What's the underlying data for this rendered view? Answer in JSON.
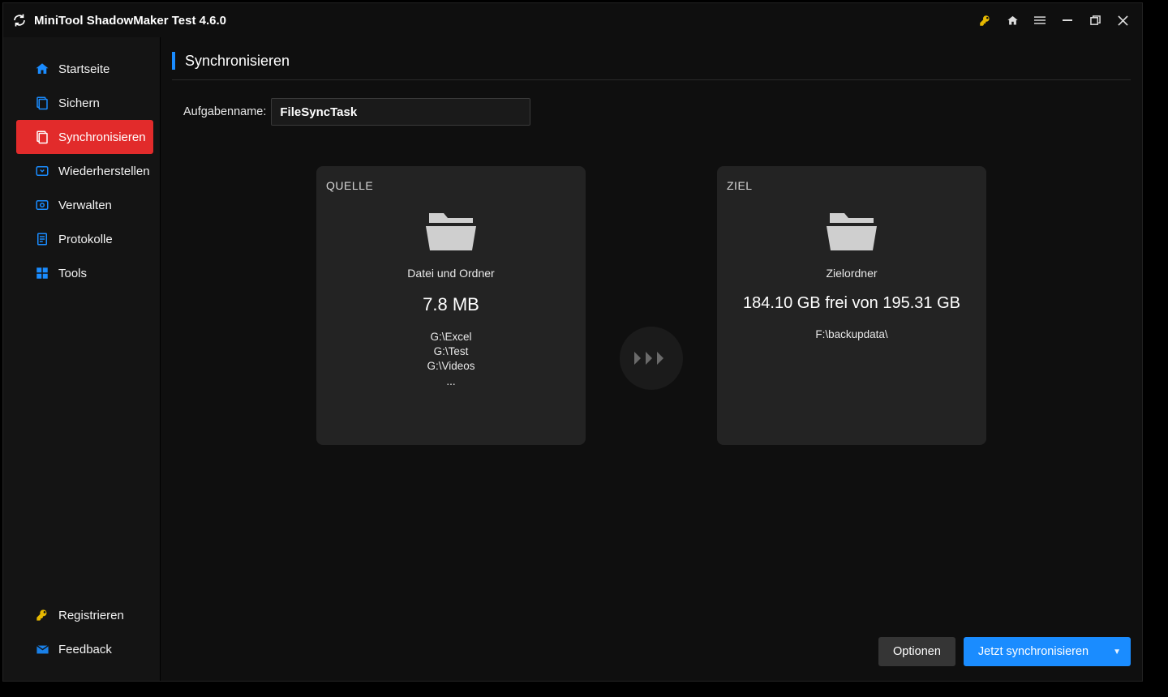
{
  "app": {
    "title": "MiniTool ShadowMaker Test 4.6.0"
  },
  "sidebar": {
    "items": [
      {
        "label": "Startseite"
      },
      {
        "label": "Sichern"
      },
      {
        "label": "Synchronisieren"
      },
      {
        "label": "Wiederherstellen"
      },
      {
        "label": "Verwalten"
      },
      {
        "label": "Protokolle"
      },
      {
        "label": "Tools"
      }
    ],
    "bottom": {
      "register": "Registrieren",
      "feedback": "Feedback"
    }
  },
  "page": {
    "title": "Synchronisieren",
    "task_label": "Aufgabenname:",
    "task_value": "FileSyncTask"
  },
  "source": {
    "heading": "QUELLE",
    "subtitle": "Datei und Ordner",
    "size": "7.8 MB",
    "paths": [
      "G:\\Excel",
      "G:\\Test",
      "G:\\Videos"
    ],
    "more": "..."
  },
  "target": {
    "heading": "ZIEL",
    "subtitle": "Zielordner",
    "free": "184.10 GB frei von 195.31 GB",
    "path": "F:\\backupdata\\"
  },
  "footer": {
    "options": "Optionen",
    "sync_now": "Jetzt synchronisieren"
  }
}
